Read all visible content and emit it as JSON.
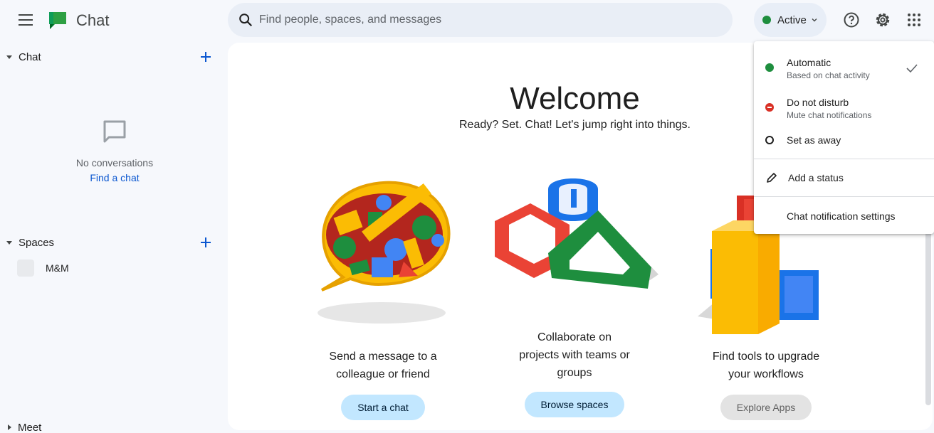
{
  "header": {
    "app_title": "Chat",
    "search_placeholder": "Find people, spaces, and messages",
    "status_label": "Active",
    "status_color": "#1e8e3e",
    "icons": [
      "menu-icon",
      "chat-logo-icon",
      "search-icon",
      "chevron-down-icon",
      "help-icon",
      "gear-icon",
      "apps-grid-icon"
    ]
  },
  "sidebar": {
    "chat_section": {
      "title": "Chat",
      "empty_text": "No conversations",
      "empty_link": "Find a chat"
    },
    "spaces_section": {
      "title": "Spaces",
      "items": [
        {
          "name": "M&M"
        }
      ]
    },
    "meet_section": {
      "title": "Meet"
    }
  },
  "main": {
    "title": "Welcome",
    "subtitle": "Ready? Set. Chat! Let's jump right into things.",
    "cards": [
      {
        "desc_line1": "Send a message to a",
        "desc_line2": "colleague or friend",
        "button": "Start a chat",
        "enabled": true
      },
      {
        "desc_line1": "Collaborate on",
        "desc_line2": "projects with teams or",
        "desc_line3": "groups",
        "button": "Browse spaces",
        "enabled": true
      },
      {
        "desc_line1": "Find tools to upgrade",
        "desc_line2": "your workflows",
        "button": "Explore Apps",
        "enabled": false
      }
    ]
  },
  "status_menu": {
    "options": [
      {
        "title": "Automatic",
        "subtitle": "Based on chat activity",
        "selected": true,
        "color": "#1e8e3e"
      },
      {
        "title": "Do not disturb",
        "subtitle": "Mute chat notifications",
        "color": "#d93025"
      },
      {
        "title": "Set as away"
      }
    ],
    "add_status": "Add a status",
    "notification_settings": "Chat notification settings"
  },
  "colors": {
    "accent": "#0b57d0",
    "button_bg": "#c2e7ff",
    "background": "#f6f8fc"
  }
}
